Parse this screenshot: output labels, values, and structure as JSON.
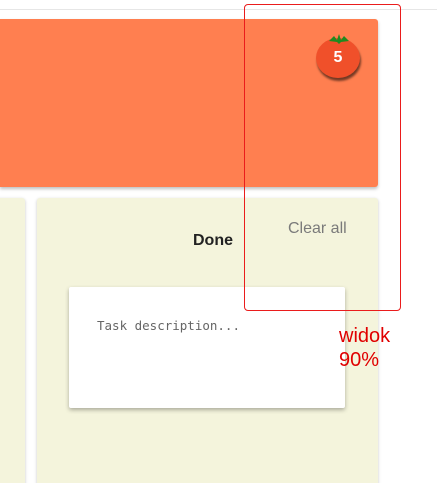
{
  "app": {
    "timer_count": "5"
  },
  "column": {
    "title": "Done",
    "clear_label": "Clear all"
  },
  "task": {
    "placeholder": "Task description..."
  },
  "annotation": {
    "line1": "widok",
    "line2": "90%"
  },
  "colors": {
    "header": "#ff7f50",
    "column_bg": "#f4f4dc",
    "tomato": "#f0502a",
    "annotation": "#ea1c1c"
  }
}
